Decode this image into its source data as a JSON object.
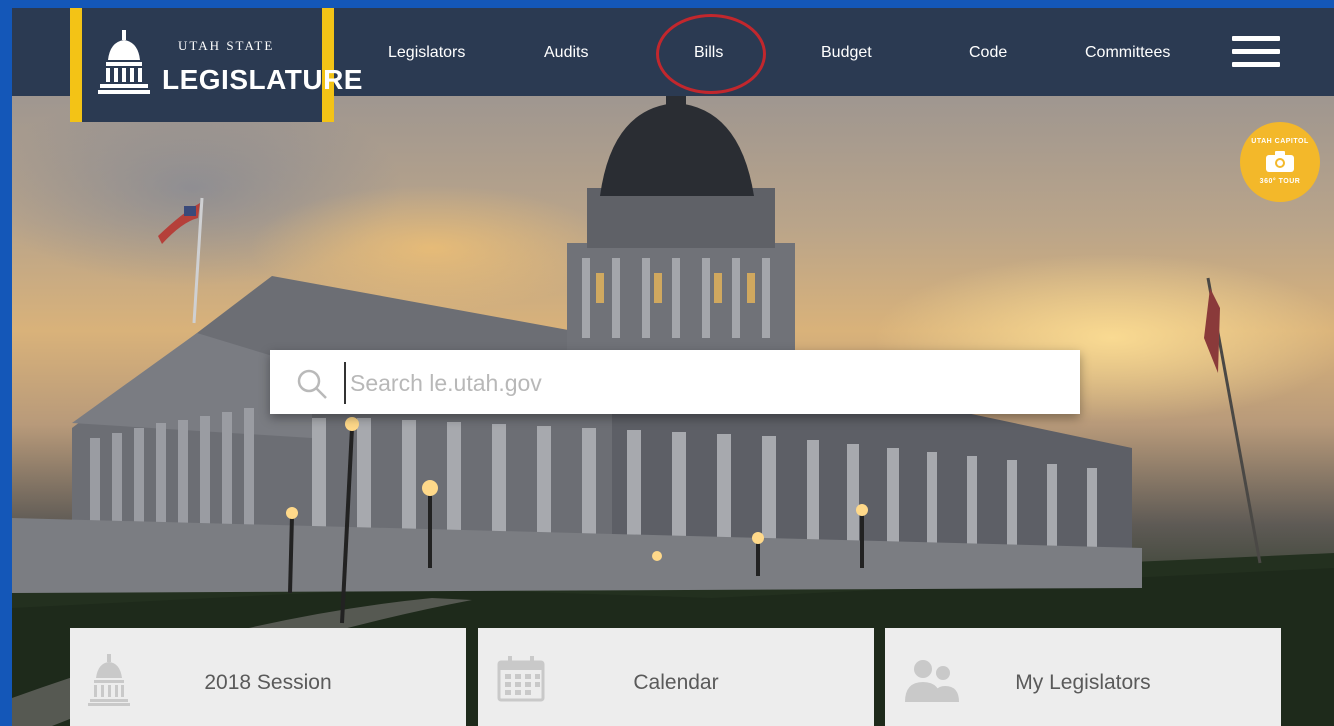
{
  "header": {
    "logo_top": "UTAH STATE",
    "logo_main": "LEGISLATURE",
    "nav": [
      {
        "label": "Legislators"
      },
      {
        "label": "Audits"
      },
      {
        "label": "Bills"
      },
      {
        "label": "Budget"
      },
      {
        "label": "Code"
      },
      {
        "label": "Committees"
      }
    ],
    "highlighted_item": "Bills"
  },
  "tour_badge": {
    "top_text": "UTAH CAPITOL",
    "bottom_text": "360° TOUR",
    "icon": "camera-icon"
  },
  "search": {
    "placeholder": "Search le.utah.gov",
    "value": ""
  },
  "cards": [
    {
      "label": "2018 Session",
      "icon": "capitol-dome-icon"
    },
    {
      "label": "Calendar",
      "icon": "calendar-icon"
    },
    {
      "label": "My Legislators",
      "icon": "people-icon"
    }
  ],
  "colors": {
    "nav_bg": "#2b3a52",
    "logo_accent": "#f3c316",
    "highlight_circle": "#c2272d",
    "badge": "#f3b82a",
    "outer_border": "#1457b8"
  }
}
